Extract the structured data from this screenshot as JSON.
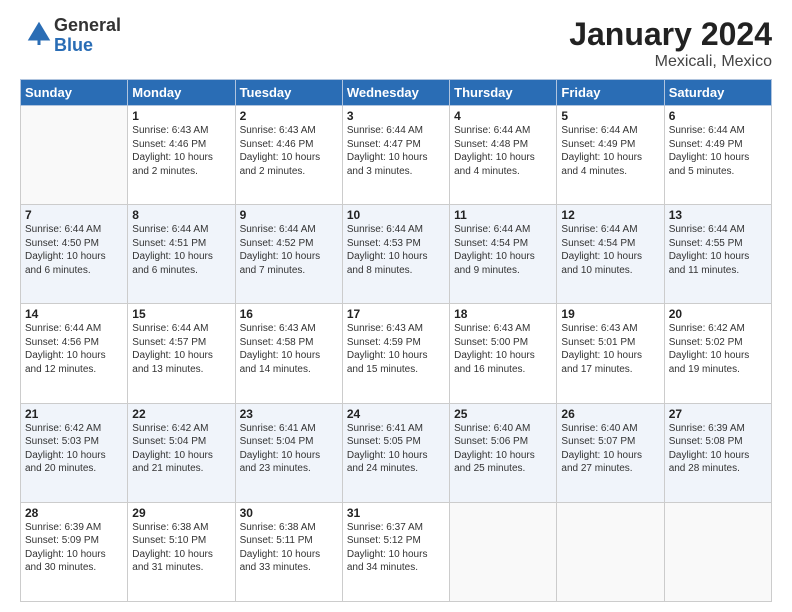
{
  "header": {
    "logo_general": "General",
    "logo_blue": "Blue",
    "month_year": "January 2024",
    "location": "Mexicali, Mexico"
  },
  "days_of_week": [
    "Sunday",
    "Monday",
    "Tuesday",
    "Wednesday",
    "Thursday",
    "Friday",
    "Saturday"
  ],
  "weeks": [
    [
      {
        "day": "",
        "info": ""
      },
      {
        "day": "1",
        "info": "Sunrise: 6:43 AM\nSunset: 4:46 PM\nDaylight: 10 hours\nand 2 minutes."
      },
      {
        "day": "2",
        "info": "Sunrise: 6:43 AM\nSunset: 4:46 PM\nDaylight: 10 hours\nand 2 minutes."
      },
      {
        "day": "3",
        "info": "Sunrise: 6:44 AM\nSunset: 4:47 PM\nDaylight: 10 hours\nand 3 minutes."
      },
      {
        "day": "4",
        "info": "Sunrise: 6:44 AM\nSunset: 4:48 PM\nDaylight: 10 hours\nand 4 minutes."
      },
      {
        "day": "5",
        "info": "Sunrise: 6:44 AM\nSunset: 4:49 PM\nDaylight: 10 hours\nand 4 minutes."
      },
      {
        "day": "6",
        "info": "Sunrise: 6:44 AM\nSunset: 4:49 PM\nDaylight: 10 hours\nand 5 minutes."
      }
    ],
    [
      {
        "day": "7",
        "info": "Sunrise: 6:44 AM\nSunset: 4:50 PM\nDaylight: 10 hours\nand 6 minutes."
      },
      {
        "day": "8",
        "info": "Sunrise: 6:44 AM\nSunset: 4:51 PM\nDaylight: 10 hours\nand 6 minutes."
      },
      {
        "day": "9",
        "info": "Sunrise: 6:44 AM\nSunset: 4:52 PM\nDaylight: 10 hours\nand 7 minutes."
      },
      {
        "day": "10",
        "info": "Sunrise: 6:44 AM\nSunset: 4:53 PM\nDaylight: 10 hours\nand 8 minutes."
      },
      {
        "day": "11",
        "info": "Sunrise: 6:44 AM\nSunset: 4:54 PM\nDaylight: 10 hours\nand 9 minutes."
      },
      {
        "day": "12",
        "info": "Sunrise: 6:44 AM\nSunset: 4:54 PM\nDaylight: 10 hours\nand 10 minutes."
      },
      {
        "day": "13",
        "info": "Sunrise: 6:44 AM\nSunset: 4:55 PM\nDaylight: 10 hours\nand 11 minutes."
      }
    ],
    [
      {
        "day": "14",
        "info": "Sunrise: 6:44 AM\nSunset: 4:56 PM\nDaylight: 10 hours\nand 12 minutes."
      },
      {
        "day": "15",
        "info": "Sunrise: 6:44 AM\nSunset: 4:57 PM\nDaylight: 10 hours\nand 13 minutes."
      },
      {
        "day": "16",
        "info": "Sunrise: 6:43 AM\nSunset: 4:58 PM\nDaylight: 10 hours\nand 14 minutes."
      },
      {
        "day": "17",
        "info": "Sunrise: 6:43 AM\nSunset: 4:59 PM\nDaylight: 10 hours\nand 15 minutes."
      },
      {
        "day": "18",
        "info": "Sunrise: 6:43 AM\nSunset: 5:00 PM\nDaylight: 10 hours\nand 16 minutes."
      },
      {
        "day": "19",
        "info": "Sunrise: 6:43 AM\nSunset: 5:01 PM\nDaylight: 10 hours\nand 17 minutes."
      },
      {
        "day": "20",
        "info": "Sunrise: 6:42 AM\nSunset: 5:02 PM\nDaylight: 10 hours\nand 19 minutes."
      }
    ],
    [
      {
        "day": "21",
        "info": "Sunrise: 6:42 AM\nSunset: 5:03 PM\nDaylight: 10 hours\nand 20 minutes."
      },
      {
        "day": "22",
        "info": "Sunrise: 6:42 AM\nSunset: 5:04 PM\nDaylight: 10 hours\nand 21 minutes."
      },
      {
        "day": "23",
        "info": "Sunrise: 6:41 AM\nSunset: 5:04 PM\nDaylight: 10 hours\nand 23 minutes."
      },
      {
        "day": "24",
        "info": "Sunrise: 6:41 AM\nSunset: 5:05 PM\nDaylight: 10 hours\nand 24 minutes."
      },
      {
        "day": "25",
        "info": "Sunrise: 6:40 AM\nSunset: 5:06 PM\nDaylight: 10 hours\nand 25 minutes."
      },
      {
        "day": "26",
        "info": "Sunrise: 6:40 AM\nSunset: 5:07 PM\nDaylight: 10 hours\nand 27 minutes."
      },
      {
        "day": "27",
        "info": "Sunrise: 6:39 AM\nSunset: 5:08 PM\nDaylight: 10 hours\nand 28 minutes."
      }
    ],
    [
      {
        "day": "28",
        "info": "Sunrise: 6:39 AM\nSunset: 5:09 PM\nDaylight: 10 hours\nand 30 minutes."
      },
      {
        "day": "29",
        "info": "Sunrise: 6:38 AM\nSunset: 5:10 PM\nDaylight: 10 hours\nand 31 minutes."
      },
      {
        "day": "30",
        "info": "Sunrise: 6:38 AM\nSunset: 5:11 PM\nDaylight: 10 hours\nand 33 minutes."
      },
      {
        "day": "31",
        "info": "Sunrise: 6:37 AM\nSunset: 5:12 PM\nDaylight: 10 hours\nand 34 minutes."
      },
      {
        "day": "",
        "info": ""
      },
      {
        "day": "",
        "info": ""
      },
      {
        "day": "",
        "info": ""
      }
    ]
  ]
}
